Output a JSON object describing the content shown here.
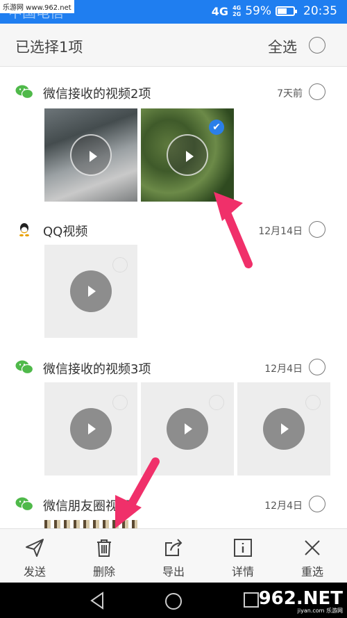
{
  "watermark": "乐游网 www.962.net",
  "statusbar": {
    "title": "中国电信",
    "network": "4G",
    "signal_top": "4G",
    "signal_bottom": "2G",
    "battery": "59%",
    "battery_level": 0.59,
    "time": "20:35"
  },
  "header": {
    "title": "已选择1项",
    "select_all": "全选"
  },
  "groups": [
    {
      "title": "微信接收的视频2项",
      "date": "7天前",
      "app": "wechat-icon"
    },
    {
      "title": "QQ视频",
      "date": "12月14日",
      "app": "qq-icon"
    },
    {
      "title": "微信接收的视频3项",
      "date": "12月4日",
      "app": "wechat-icon"
    },
    {
      "title": "微信朋友圈视频",
      "date": "12月4日",
      "app": "wechat-icon"
    }
  ],
  "toolbar": {
    "send": "发送",
    "delete": "删除",
    "export": "导出",
    "details": "详情",
    "reselect": "重选"
  },
  "logo": {
    "main": "962.NET",
    "sub": "jiyan.com 乐游网"
  },
  "colors": {
    "status_bar": "#1f7ef0",
    "accent_check": "#2b7fe8",
    "arrow": "#f0306a",
    "wechat": "#4fb94a"
  }
}
